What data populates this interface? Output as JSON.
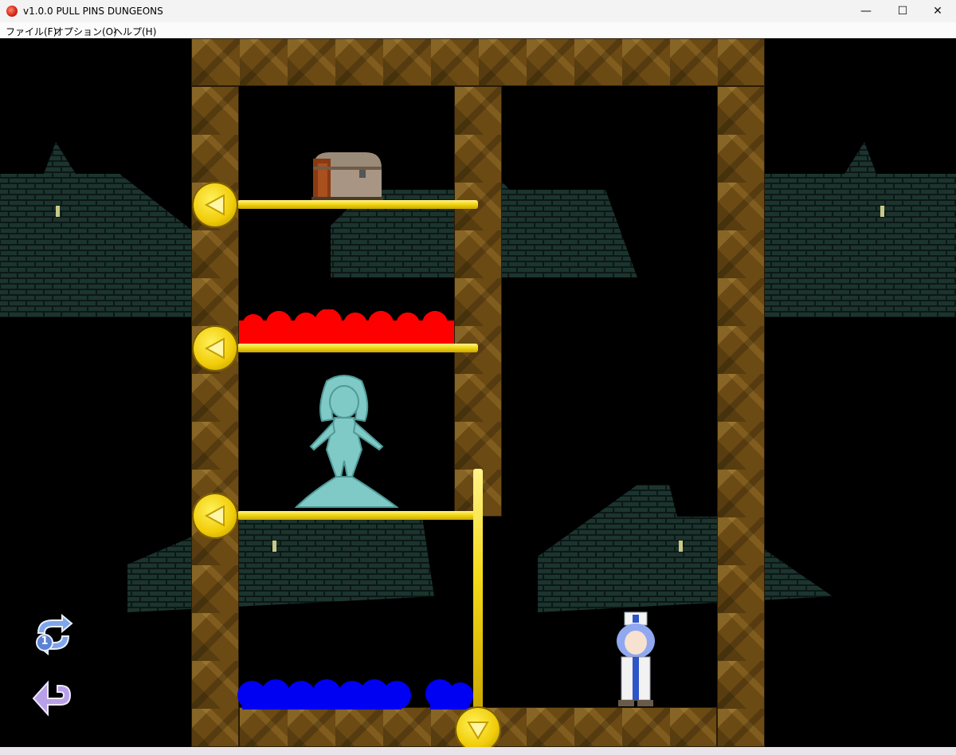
{
  "window": {
    "title": "v1.0.0 PULL PINS DUNGEONS",
    "minimize": "—",
    "maximize": "☐",
    "close": "✕"
  },
  "menu": {
    "file": "ファイル(F)",
    "options": "オプション(O)",
    "help": "ヘルプ(H)"
  },
  "hud": {
    "retry_count": "1"
  },
  "colors": {
    "lava": "#ff0000",
    "water": "#0000ff",
    "pin": "#f4d916",
    "dirt": "#6b4a14",
    "bg_brick": "#1f3a33"
  },
  "icons": {
    "retry": "retry-icon",
    "undo": "undo-icon",
    "chest": "treasure-chest-icon",
    "slime": "slime-girl-enemy",
    "hero": "priestess-hero"
  }
}
